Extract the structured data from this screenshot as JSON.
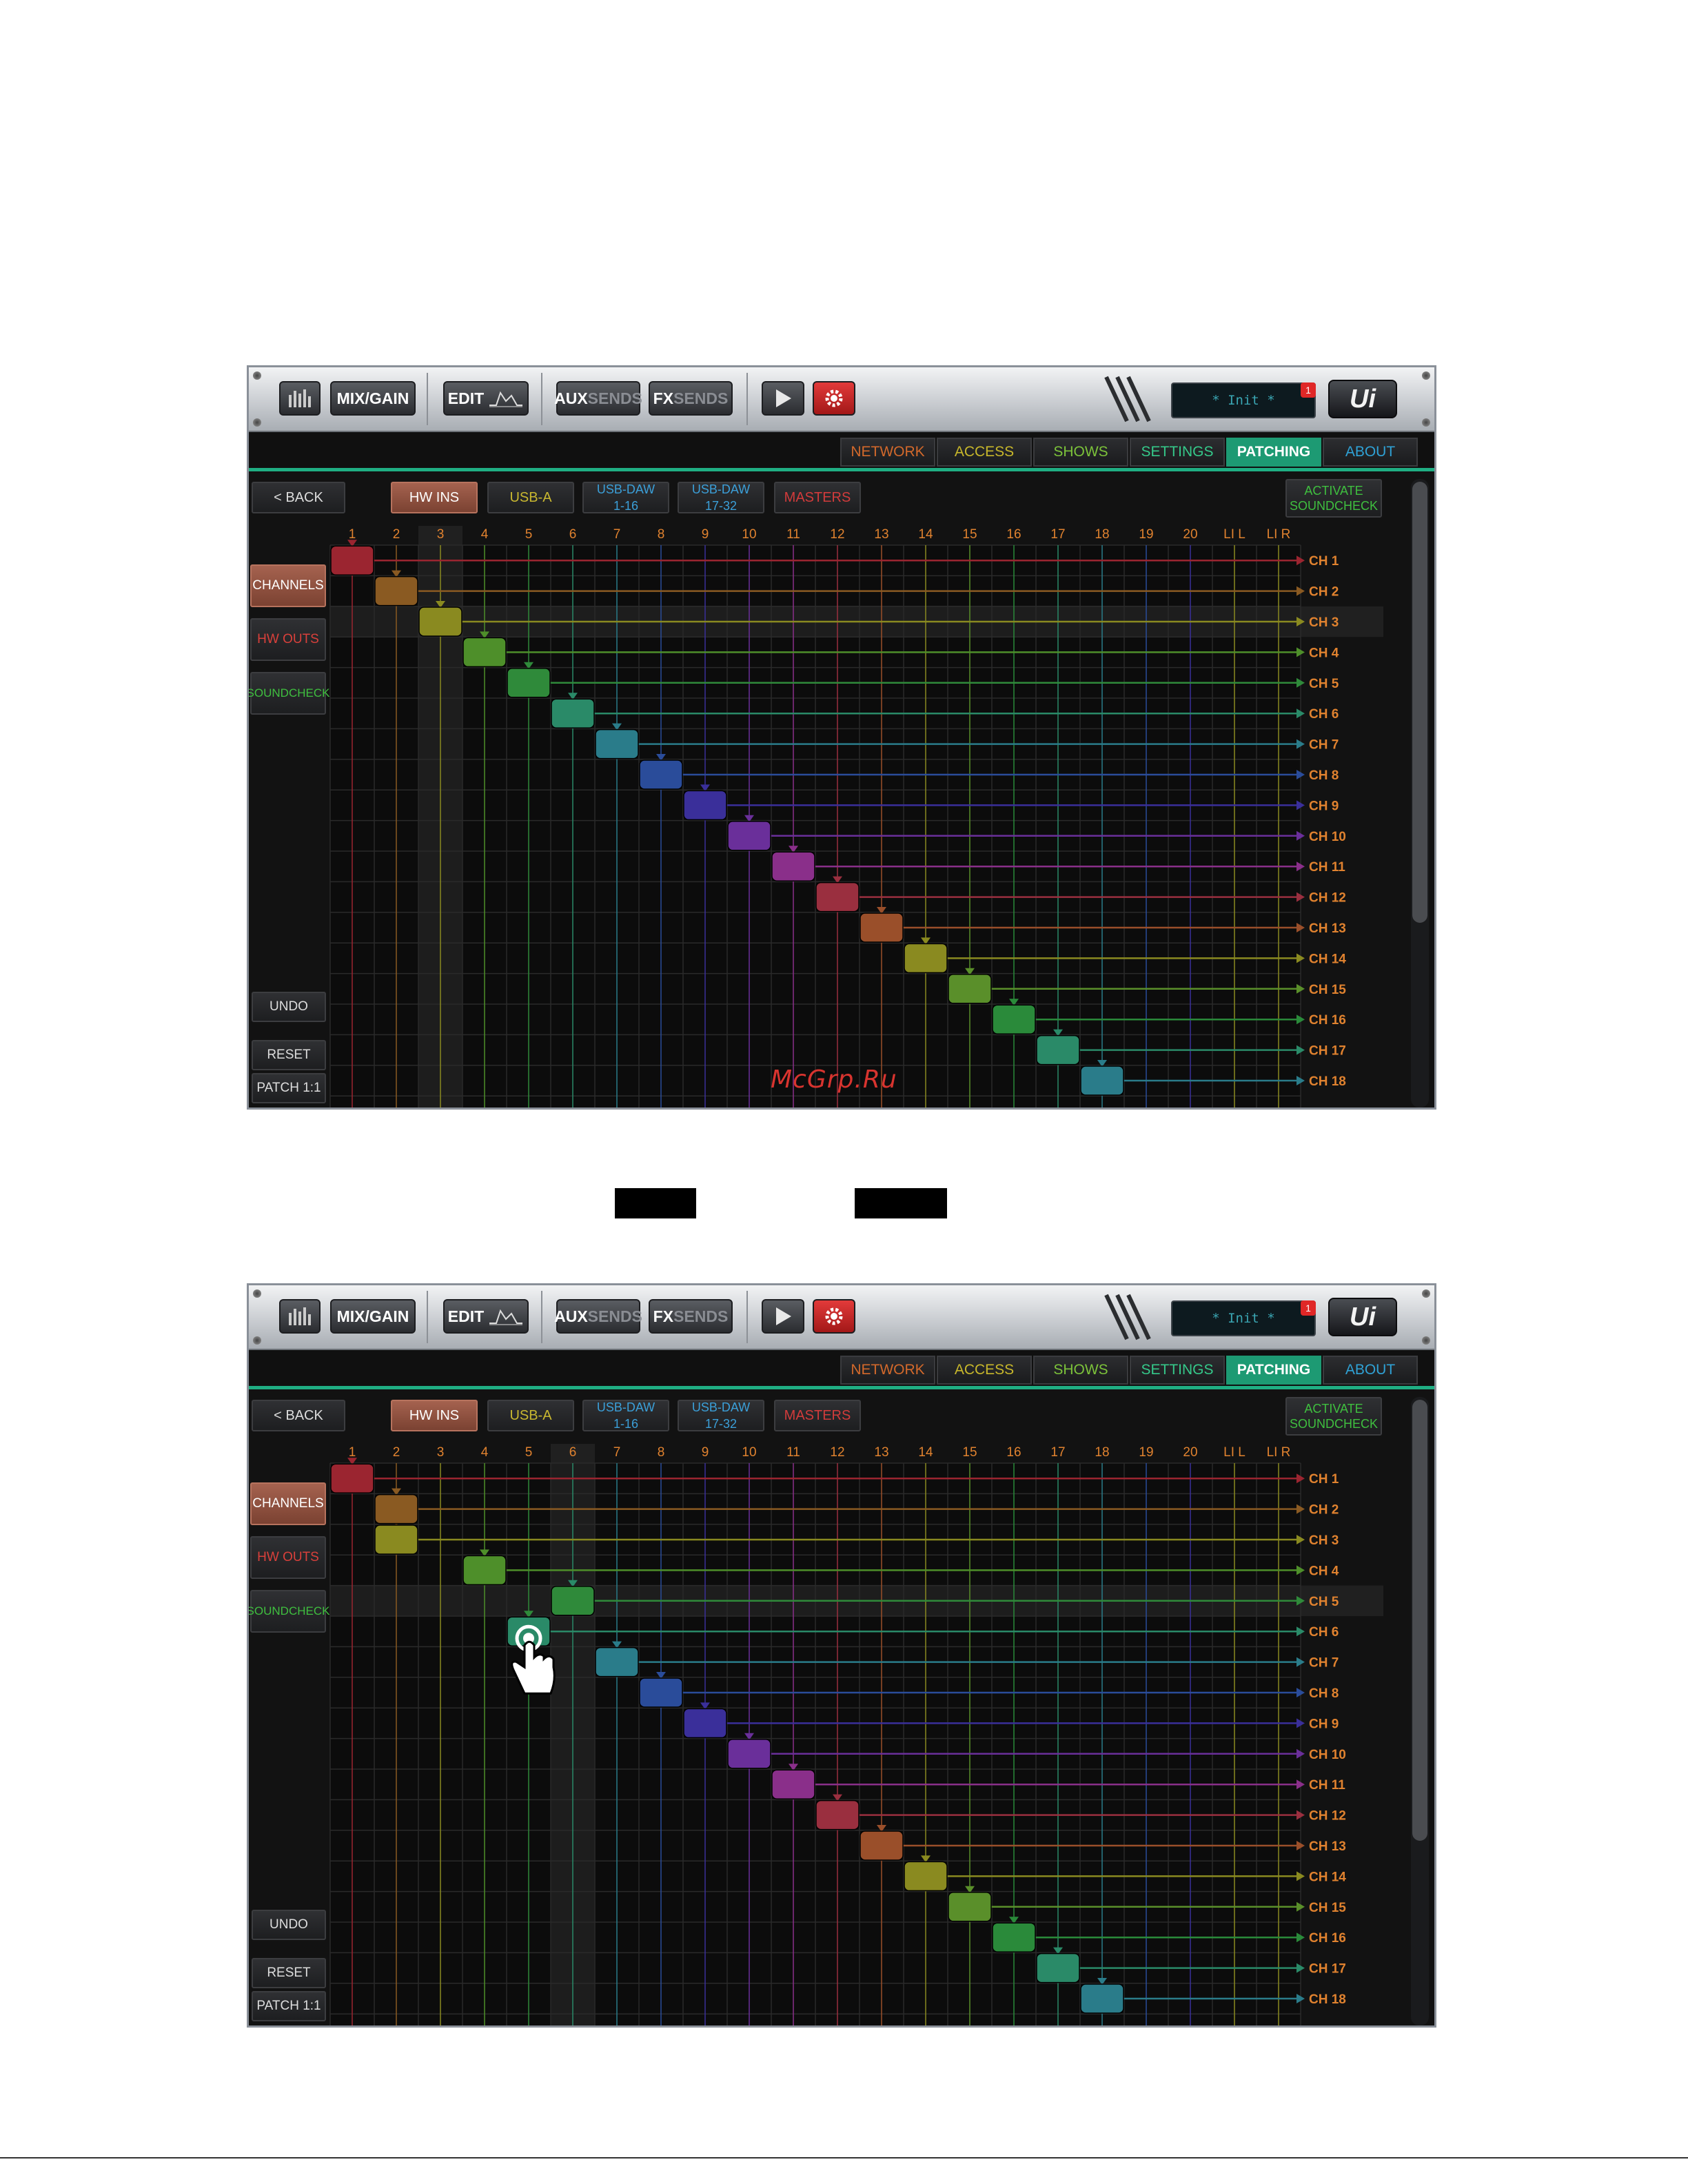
{
  "toolbar": {
    "mix_gain": "MIX/GAIN",
    "edit": "EDIT",
    "aux_a": "AUX",
    "aux_b": "SENDS",
    "fx_a": "FX",
    "fx_b": "SENDS",
    "show_name": "* Init *",
    "notification_count": "1",
    "logo": "Ui"
  },
  "tabs": [
    {
      "label": "NETWORK",
      "color": "#d3692b",
      "active": false
    },
    {
      "label": "ACCESS",
      "color": "#c7b72b",
      "active": false
    },
    {
      "label": "SHOWS",
      "color": "#7cc33a",
      "active": false
    },
    {
      "label": "SETTINGS",
      "color": "#35c98a",
      "active": false
    },
    {
      "label": "PATCHING",
      "color": "#ffffff",
      "active": true
    },
    {
      "label": "ABOUT",
      "color": "#2fa2d6",
      "active": false
    }
  ],
  "source_tabs": {
    "back": "< BACK",
    "hw_ins": "HW INS",
    "usb_a": "USB-A",
    "usb_daw_1": "USB-DAW\n1-16",
    "usb_daw_2": "USB-DAW\n17-32",
    "masters": "MASTERS",
    "activate": "ACTIVATE\nSOUNDCHECK"
  },
  "sidebar": {
    "channels": "CHANNELS",
    "hw_outs": "HW OUTS",
    "soundcheck": "SOUNDCHECK",
    "undo": "UNDO",
    "reset": "RESET",
    "patch": "PATCH 1:1"
  },
  "columns": [
    "1",
    "2",
    "3",
    "4",
    "5",
    "6",
    "7",
    "8",
    "9",
    "10",
    "11",
    "12",
    "13",
    "14",
    "15",
    "16",
    "17",
    "18",
    "19",
    "20",
    "LI L",
    "LI R"
  ],
  "rows": [
    "CH 1",
    "CH 2",
    "CH 3",
    "CH 4",
    "CH 5",
    "CH 6",
    "CH 7",
    "CH 8",
    "CH 9",
    "CH 10",
    "CH 11",
    "CH 12",
    "CH 13",
    "CH 14",
    "CH 15",
    "CH 16",
    "CH 17",
    "CH 18"
  ],
  "row_colors": [
    "#9b2530",
    "#8a5a22",
    "#8a8a20",
    "#4e8f2a",
    "#2f8a3a",
    "#2a8a68",
    "#2a7c8a",
    "#2a4c9a",
    "#3a2f9a",
    "#6a2f9a",
    "#8a2f8a",
    "#9a2f3f",
    "#9a4f2a",
    "#8a8a20",
    "#5a8f2a",
    "#2a8a3a",
    "#2a8a68",
    "#2a7c8a"
  ],
  "patches": [
    {
      "highlight_col": 2,
      "highlight_row": 2,
      "map": [
        0,
        1,
        2,
        3,
        4,
        5,
        6,
        7,
        8,
        9,
        10,
        11,
        12,
        13,
        14,
        15,
        16,
        17
      ],
      "touch": null
    },
    {
      "highlight_col": 5,
      "highlight_row": 4,
      "map": [
        0,
        1,
        1,
        3,
        5,
        4,
        6,
        7,
        8,
        9,
        10,
        11,
        12,
        13,
        14,
        15,
        16,
        17
      ],
      "touch": 5
    }
  ],
  "watermark": "McGrp.Ru"
}
